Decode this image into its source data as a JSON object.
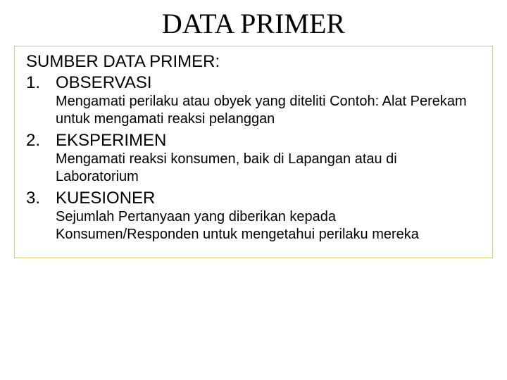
{
  "title": "DATA PRIMER",
  "heading": "SUMBER DATA PRIMER:",
  "items": [
    {
      "number": "1.",
      "label": "OBSERVASI",
      "desc": "Mengamati perilaku atau obyek yang diteliti Contoh: Alat Perekam untuk  mengamati reaksi pelanggan"
    },
    {
      "number": "2.",
      "label": "EKSPERIMEN",
      "desc": "Mengamati reaksi konsumen, baik di Lapangan atau di Laboratorium"
    },
    {
      "number": "3.",
      "label": "KUESIONER",
      "desc": "Sejumlah Pertanyaan yang diberikan kepada Konsumen/Responden untuk mengetahui perilaku mereka"
    }
  ]
}
